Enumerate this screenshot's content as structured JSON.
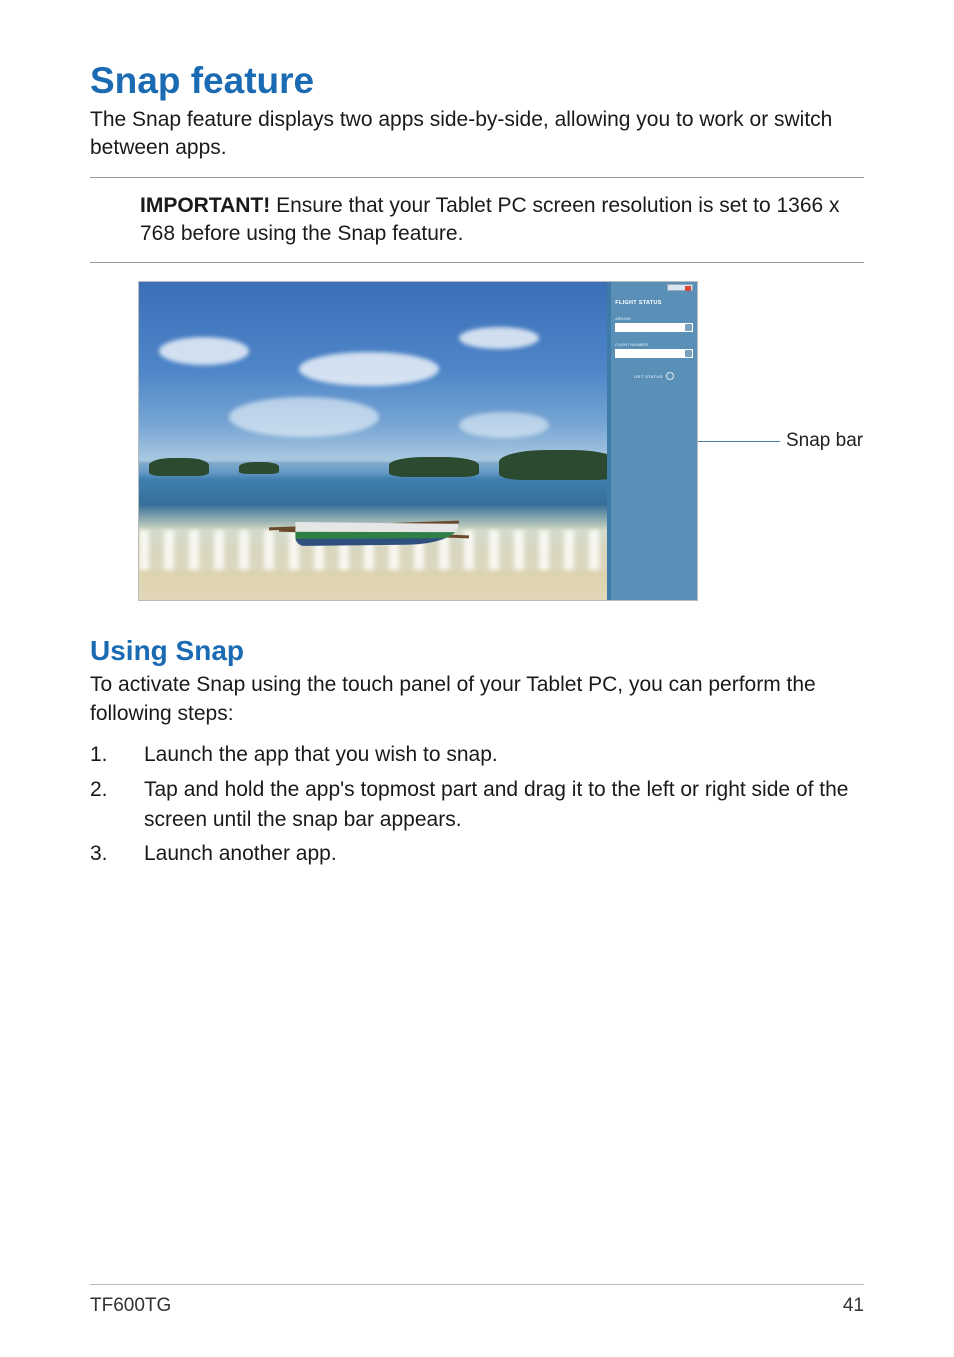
{
  "heading": "Snap feature",
  "intro": "The Snap feature displays two apps side-by-side, allowing you to work or switch between apps.",
  "important": {
    "label": "IMPORTANT!",
    "text": "  Ensure that your Tablet PC screen resolution is set to 1366 x 768 before using the Snap feature."
  },
  "figure": {
    "callout": "Snap bar",
    "app_panel": {
      "title": "FLIGHT STATUS",
      "field1_label": "AIRLINE",
      "field2_label": "FLIGHT NUMBER",
      "button": "GET STATUS"
    }
  },
  "sub": {
    "heading": "Using Snap",
    "intro": "To activate Snap using the touch panel of your Tablet PC, you can perform the following steps:",
    "steps": [
      {
        "n": "1.",
        "t": "Launch the app that you wish to snap."
      },
      {
        "n": "2.",
        "t": "Tap and hold the app's topmost part and drag it to the left or right side of the screen until the snap bar appears."
      },
      {
        "n": "3.",
        "t": "Launch another app."
      }
    ]
  },
  "footer": {
    "model": "TF600TG",
    "page": "41"
  }
}
